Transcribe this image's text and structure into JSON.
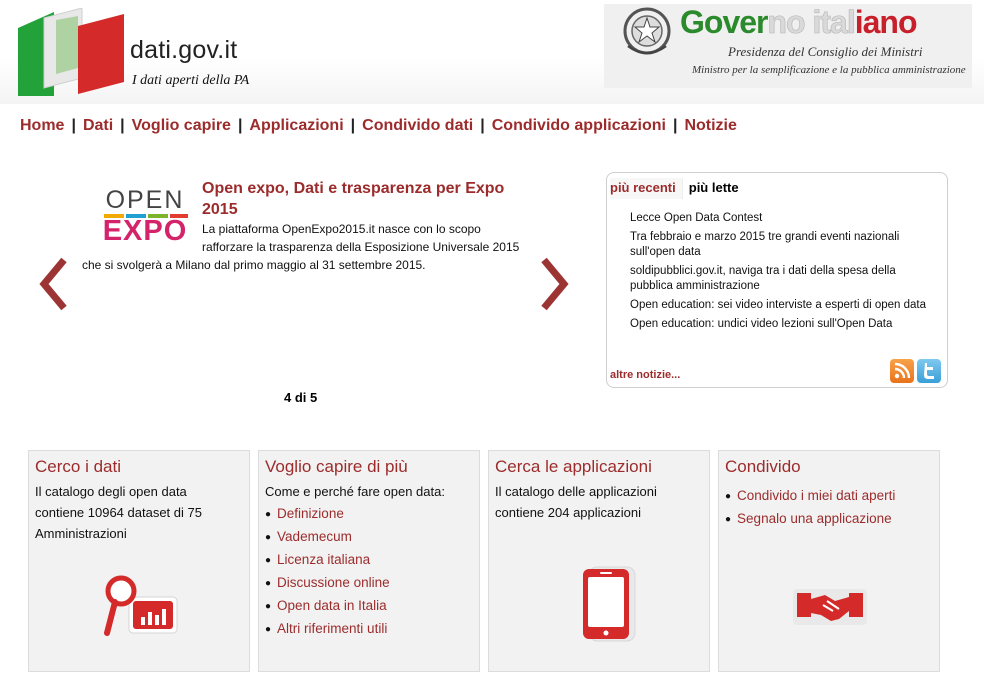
{
  "header": {
    "site_name": "dati.gov.it",
    "site_tagline": "I dati aperti della PA",
    "gov_title_part1": "Gover",
    "gov_title_part2": "no ital",
    "gov_title_part3": "iano",
    "gov_subtitle1": "Presidenza del Consiglio dei Ministri",
    "gov_subtitle2": "Ministro per la semplificazione e la pubblica amministrazione"
  },
  "nav": {
    "items": [
      "Home",
      "Dati",
      "Voglio capire",
      "Applicazioni",
      "Condivido dati",
      "Condivido applicazioni",
      "Notizie"
    ],
    "separator": "|"
  },
  "carousel": {
    "logo_line1": "OPEN",
    "logo_line2": "EXPO",
    "title": "Open expo, Dati e trasparenza per Expo 2015",
    "text_part1": "La piattaforma OpenExpo2015.it nasce con lo scopo rafforzare la trasparenza della Esposizione Universale 2015",
    "text_part2": "che si svolgerà a Milano dal primo maggio al 31 settembre 2015.",
    "counter": "4 di 5"
  },
  "news": {
    "tab_recent": "più recenti",
    "tab_read": "più lette",
    "items": [
      "Lecce Open Data Contest",
      "Tra febbraio e marzo 2015 tre grandi eventi nazionali sull'open data",
      "soldipubblici.gov.it, naviga tra i dati della spesa della pubblica amministrazione",
      "Open education: sei video interviste a esperti di open data",
      "Open education: undici video lezioni sull'Open Data"
    ],
    "more": "altre notizie..."
  },
  "cards": {
    "c1": {
      "title": "Cerco i dati",
      "text": "Il catalogo degli open data contiene 10964 dataset di 75 Amministrazioni"
    },
    "c2": {
      "title": "Voglio capire di più",
      "text": "Come e perché fare open data:",
      "links": [
        "Definizione",
        "Vademecum",
        "Licenza italiana",
        "Discussione online",
        "Open data in Italia",
        "Altri riferimenti utili"
      ]
    },
    "c3": {
      "title": "Cerca le applicazioni",
      "text": "Il catalogo delle applicazioni contiene 204 applicazioni"
    },
    "c4": {
      "title": "Condivido",
      "links": [
        "Condivido i miei dati aperti",
        "Segnalo una applicazione"
      ]
    }
  },
  "colors": {
    "accent": "#9c2c2c",
    "green": "#2b8a2b",
    "red": "#c8202b",
    "card_bg": "#f2f2f2"
  }
}
